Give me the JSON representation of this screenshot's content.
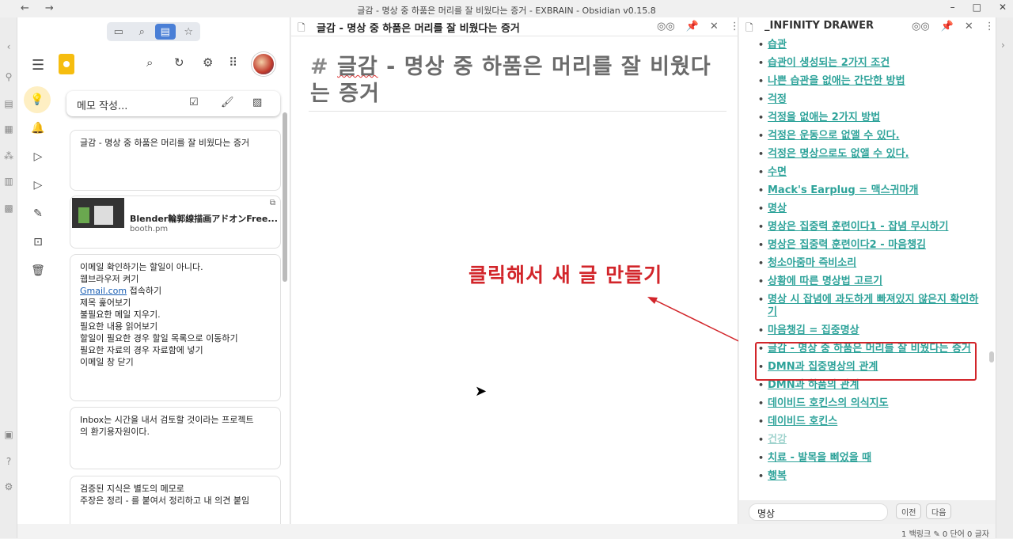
{
  "window": {
    "title": "글감 - 명상 중 하품은 머리를 잘 비웠다는 증거 - EXBRAIN - Obsidian v0.15.8",
    "back": "←",
    "forward": "→",
    "minimize": "–",
    "maximize": "□",
    "close": "✕"
  },
  "tabs": {
    "files": "▭",
    "search": "⌕",
    "active": "▤",
    "star": "☆"
  },
  "keep": {
    "memo_placeholder": "메모 작성...",
    "notes": [
      {
        "lines": [
          "글감 - 명상 중 하품은 머리를 잘 비웠다는 증거"
        ]
      },
      {
        "link_title": "Blender輪郭線描画アドオンFree...",
        "link_domain": "booth.pm"
      },
      {
        "lines_before": [
          "이메일 확인하기는 할일이 아니다.",
          "웹브라우저 켜기"
        ],
        "link": "Gmail.com",
        "link_suffix": " 접속하기",
        "lines_after": [
          "제목 훑어보기",
          "불필요한 메일 지우기.",
          "필요한 내용 읽어보기",
          "할일이 필요한 경우 할일 목록으로 이동하기",
          "필요한 자료의 경우 자료함에 넣기",
          "이메일 창 닫기"
        ]
      },
      {
        "lines": [
          "Inbox는 시간을 내서 검토할 것이라는 프로젝트",
          "의 환기용자원이다."
        ]
      },
      {
        "lines": [
          "검증된 지식은 별도의 메모로",
          "주장은 정리 - 를 붙여서 정리하고 내 의견 붙임"
        ]
      }
    ]
  },
  "editor": {
    "tab_title": "글감 - 명상 중 하품은 머리를 잘 비웠다는 증거",
    "heading_hash": "#",
    "heading_word": "글감",
    "heading_rest": " - 명상 중 하품은 머리를 잘 비웠다는 증거",
    "annotation": "클릭해서 새 글 만들기"
  },
  "drawer": {
    "title": "_INFINITY DRAWER",
    "items": [
      "습관",
      "습관이 생성되는 2가지 조건",
      "나쁜 습관을 없애는 간단한 방법",
      "걱정",
      "걱정을 없애는 2가지 방법",
      "걱정은 운동으로 없앨 수 있다.",
      "걱정은 명상으로도 없앨 수 있다.",
      "수면",
      "Mack's Earplug = 맥스귀마개",
      "명상",
      "명상은 집중력 훈련이다1 - 잡념 무시하기",
      "명상은 집중력 훈련이다2 - 마음챙김",
      "청소아줌마 즉비소리",
      "상황에 따른 명상법 고르기",
      "명상 시 잡념에 과도하게 빠져있지 않은지 확인하기",
      "마음챙김 = 집중명상",
      "글감 - 명상 중 하품은 머리를 잘 비웠다는 증거",
      "DMN과 집중명상의 관계",
      "DMN과 하품의 관계",
      "데이비드 호킨스의 의식지도",
      "데이비드 호킨스",
      "건강",
      "치료 - 발목을 삐었을 때",
      "행복"
    ],
    "search_value": "명상",
    "prev_label": "이전",
    "next_label": "다음"
  },
  "status": {
    "text": "1 백링크   ✎ 0 단어  0 글자"
  },
  "colors": {
    "accent": "#4a7fd6",
    "link": "#2ea39a",
    "annotation": "#d2252a"
  }
}
